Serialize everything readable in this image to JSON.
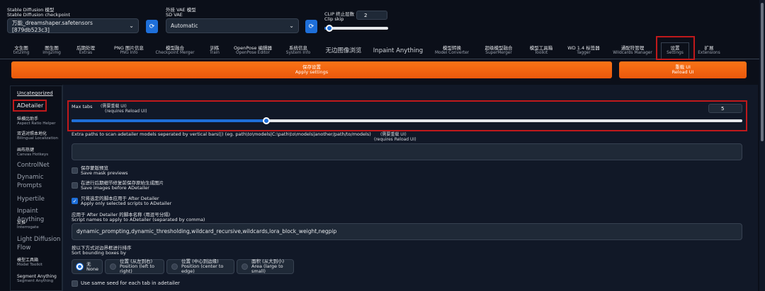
{
  "checkpoint": {
    "label_cn": "Stable Diffusion 模型",
    "label_en": "Stable Diffusion checkpoint",
    "value": "万能_dreamshaper.safetensors [879db523c3]"
  },
  "vae": {
    "label_cn": "外挂 VAE 模型",
    "label_en": "SD VAE",
    "value": "Automatic"
  },
  "clip_skip": {
    "label_cn": "CLIP 终止层数",
    "label_en": "Clip skip",
    "value": "2",
    "slider_fraction": 0.08
  },
  "tabs": [
    {
      "cn": "文生图",
      "en": "txt2img"
    },
    {
      "cn": "图生图",
      "en": "img2img"
    },
    {
      "cn": "后期处理",
      "en": "Extras"
    },
    {
      "cn": "PNG 图片信息",
      "en": "PNG Info"
    },
    {
      "cn": "模型融合",
      "en": "Checkpoint Merger"
    },
    {
      "cn": "训练",
      "en": "Train"
    },
    {
      "cn": "OpenPose 编辑器",
      "en": "OpenPose Editor"
    },
    {
      "cn": "系统信息",
      "en": "System Info"
    },
    {
      "cn": "无边图像浏览",
      "en": ""
    },
    {
      "cn": "Inpaint Anything",
      "en": ""
    },
    {
      "cn": "模型转换",
      "en": "Model Converter"
    },
    {
      "cn": "超级模型融合",
      "en": "SuperMerger"
    },
    {
      "cn": "模型工具箱",
      "en": "Toolkit"
    },
    {
      "cn": "WD 1.4 标签器",
      "en": "Tagger"
    },
    {
      "cn": "通配符管理",
      "en": "Wildcards Manager"
    },
    {
      "cn": "设置",
      "en": "Settings"
    },
    {
      "cn": "扩展",
      "en": "Extensions"
    }
  ],
  "buttons": {
    "apply_cn": "保存设置",
    "apply_en": "Apply settings",
    "reload_cn": "重载 UI",
    "reload_en": "Reload UI"
  },
  "sidebar": [
    {
      "a": "Uncategorized",
      "b": ""
    },
    {
      "a": "ADetailer",
      "b": ""
    },
    {
      "a": "纵横比助手",
      "b": "Aspect Ratio Helper"
    },
    {
      "a": "双语对照本地化",
      "b": "Bilingual Localization"
    },
    {
      "a": "画布热键",
      "b": "Canvas Hotkeys"
    },
    {
      "a": "ControlNet",
      "b": ""
    },
    {
      "a": "Dynamic",
      "b": ""
    },
    {
      "a": "Prompts",
      "b": ""
    },
    {
      "a": "Hypertile",
      "b": ""
    },
    {
      "a": "Inpaint Anything",
      "b": ""
    },
    {
      "a": "反推",
      "b": "Interrogate"
    },
    {
      "a": "Light Diffusion",
      "b": ""
    },
    {
      "a": "Flow",
      "b": ""
    },
    {
      "a": "模型工具箱",
      "b": "Model Toolkit"
    },
    {
      "a": "Segment Anything",
      "b": "Segment Anything"
    }
  ],
  "settings": {
    "max_tabs": {
      "label": "Max tabs",
      "note_cn": "(需要重载 UI)",
      "note_en": "(requires Reload UI)",
      "value": "5",
      "fraction": 0.29
    },
    "extra_paths": {
      "label": "Extra paths to scan adetailer models seperated by vertical bars(|) (eg. path\\to\\models|C:\\path\\to\\models|another/path/to/models)",
      "note_cn": "(需要重载 UI)",
      "note_en": "(requires Reload UI)",
      "value": ""
    },
    "save_previews": {
      "cn": "保存蒙版预览",
      "en": "Save mask previews",
      "checked": false
    },
    "save_before": {
      "cn": "在进行后期细节修复前保存原始生成图片",
      "en": "Save images before ADetailer",
      "checked": false
    },
    "only_selected": {
      "cn": "只将选定的脚本应用于 After Detailer",
      "en": "Apply only selected scripts to ADetailer",
      "checked": true,
      "mark": "✓"
    },
    "script_names": {
      "label_cn": "应用于 After Detailer 的脚本名称 (用逗号分隔)",
      "label_en": "Script names to apply to ADetailer (separated by comma)",
      "value": "dynamic_prompting,dynamic_thresholding,wildcard_recursive,wildcards,lora_block_weight,negpip"
    },
    "sort": {
      "label_cn": "按以下方式对边界框进行排序",
      "label_en": "Sort bounding boxes by",
      "options": [
        {
          "cn": "无",
          "en": "None",
          "selected": true
        },
        {
          "cn": "位置 (从左到右)",
          "en": "Position (left to right)",
          "selected": false
        },
        {
          "cn": "位置 (中心到边缘)",
          "en": "Position (center to edge)",
          "selected": false
        },
        {
          "cn": "面积 (从大到小)",
          "en": "Area (large to small)",
          "selected": false
        }
      ]
    },
    "same_seed": {
      "label": "Use same seed for each tab in adetailer",
      "checked": false
    }
  },
  "icons": {
    "refresh": "refresh-icon",
    "chevron": "chevron-down-icon",
    "refresh_glyph": "⟳",
    "chevron_glyph": "⌄"
  },
  "colors": {
    "accent": "#1e6fd9",
    "orange": "#f97316",
    "highlight": "#c0191b"
  }
}
